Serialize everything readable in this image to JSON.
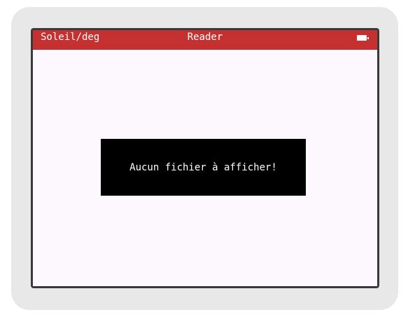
{
  "status_bar": {
    "left_label": "Soleil/deg",
    "title": "Reader",
    "battery_icon": "battery-full-icon",
    "background_color": "#c53131"
  },
  "message": {
    "text": "Aucun fichier à afficher!"
  },
  "colors": {
    "screen_background": "#fdf8fd",
    "message_background": "#000000",
    "frame": "#e8e8e8",
    "bezel": "#3a3a3a"
  }
}
